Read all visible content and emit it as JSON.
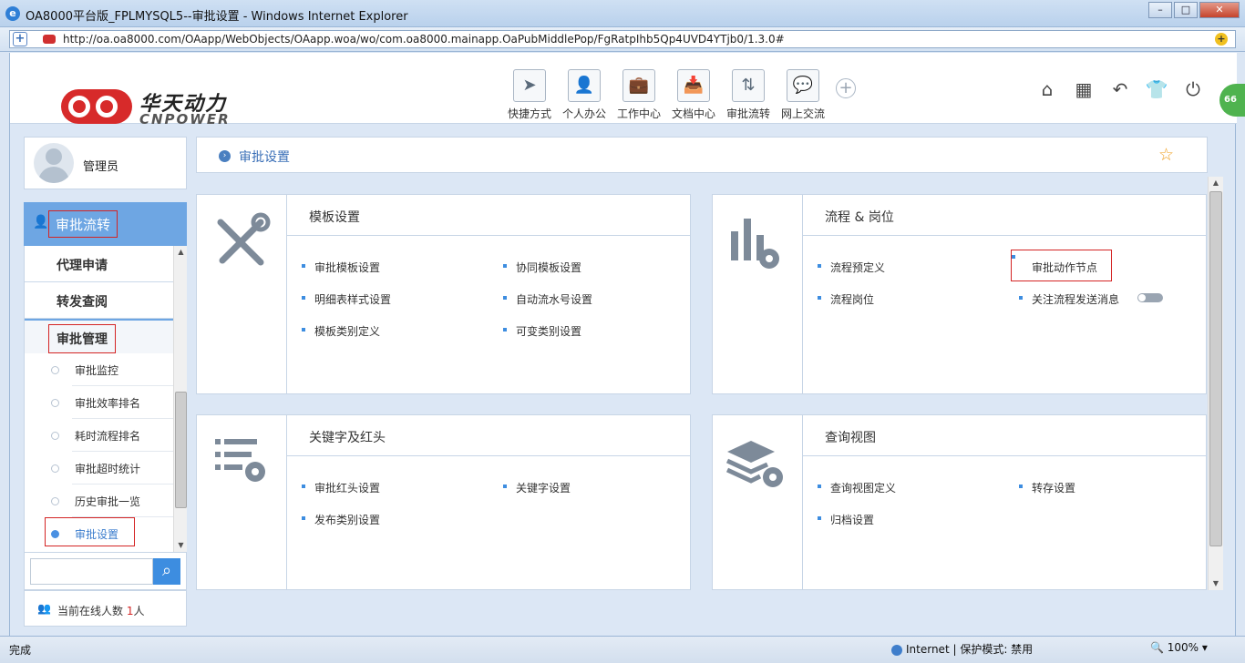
{
  "window": {
    "title": "OA8000平台版_FPLMYSQL5--审批设置 - Windows Internet Explorer",
    "url": "http://oa.oa8000.com/OAapp/WebObjects/OAapp.woa/wo/com.oa8000.mainapp.OaPubMiddlePop/FgRatpIhb5Qp4UVD4YTjb0/1.3.0#",
    "minimize": "–",
    "maximize": "□",
    "close": "✕"
  },
  "brand": {
    "name_cn": "华天动力",
    "name_en": "CNPOWER"
  },
  "topnav": [
    {
      "label": "快捷方式",
      "icon": "send-icon",
      "glyph": "➤"
    },
    {
      "label": "个人办公",
      "icon": "person-icon",
      "glyph": "👤"
    },
    {
      "label": "工作中心",
      "icon": "briefcase-icon",
      "glyph": "💼"
    },
    {
      "label": "文档中心",
      "icon": "inbox-icon",
      "glyph": "📥"
    },
    {
      "label": "审批流转",
      "icon": "flow-icon",
      "glyph": "⇅"
    },
    {
      "label": "网上交流",
      "icon": "chat-icon",
      "glyph": "💬"
    }
  ],
  "add_glyph": "+",
  "right_icons": [
    {
      "name": "home-icon",
      "glyph": "⌂"
    },
    {
      "name": "apps-grid-icon",
      "glyph": "▦"
    },
    {
      "name": "back-icon",
      "glyph": "↶"
    },
    {
      "name": "skin-icon",
      "glyph": "👕"
    },
    {
      "name": "power-icon",
      "glyph": "⏻"
    }
  ],
  "bubble_count": "66",
  "user": {
    "name": "管理员"
  },
  "sidebar": {
    "section_title": "审批流转",
    "items": [
      "代理申请",
      "转发查阅"
    ],
    "group_title": "审批管理",
    "sub_items": [
      "审批监控",
      "审批效率排名",
      "耗时流程排名",
      "审批超时统计",
      "历史审批一览",
      "审批设置"
    ],
    "active_sub": "审批设置"
  },
  "search": {
    "placeholder": ""
  },
  "online": {
    "prefix": "当前在线人数",
    "count": "1",
    "suffix": "人"
  },
  "breadcrumb": {
    "label": "审批设置"
  },
  "panels": {
    "template": {
      "title": "模板设置",
      "links": [
        "审批模板设置",
        "协同模板设置",
        "明细表样式设置",
        "自动流水号设置",
        "模板类别定义",
        "可变类别设置"
      ]
    },
    "flow": {
      "title": "流程 & 岗位",
      "links": [
        "流程预定义",
        "审批动作节点",
        "流程岗位",
        "关注流程发送消息"
      ]
    },
    "keyword": {
      "title": "关键字及红头",
      "links": [
        "审批红头设置",
        "关键字设置",
        "发布类别设置"
      ]
    },
    "query": {
      "title": "查询视图",
      "links": [
        "查询视图定义",
        "转存设置",
        "归档设置"
      ]
    }
  },
  "status": {
    "left": "完成",
    "zone": "Internet | 保护模式: 禁用",
    "zoom": "100%"
  },
  "colors": {
    "accent": "#6ea6e3",
    "highlight_border": "#d42424",
    "brand_red": "#d72a2a"
  }
}
